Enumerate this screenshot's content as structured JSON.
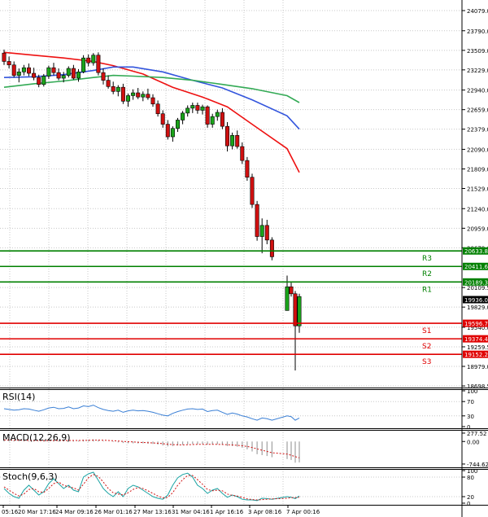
{
  "chart_data": {
    "type": "candlestick",
    "price_axis": {
      "ticks": [
        "24079.0",
        "23790.0",
        "23509.0",
        "23229.0",
        "22940.0",
        "22659.0",
        "22379.0",
        "22090.0",
        "21809.0",
        "21529.0",
        "21240.0",
        "20959.0",
        "20679.0",
        "20109.5",
        "19829.0",
        "19540.0",
        "19259.5",
        "18979.0",
        "18698.5"
      ],
      "current_price_label": "19936.0",
      "range": [
        18650,
        24120
      ]
    },
    "time_axis": {
      "labels": [
        "05:16",
        "20 Mar 17:16",
        "24 Mar 09:16",
        "26 Mar 01:16",
        "27 Mar 13:16",
        "31 Mar 04:16",
        "1 Apr 16:16",
        "3 Apr 08:16",
        "7 Apr 00:16"
      ]
    },
    "levels": [
      {
        "name": "R3",
        "value": 20633.8,
        "label": "20633.8",
        "color": "#008000"
      },
      {
        "name": "R2",
        "value": 20411.6,
        "label": "20411.6",
        "color": "#008000"
      },
      {
        "name": "R1",
        "value": 20189.3,
        "label": "20189.3",
        "color": "#008000"
      },
      {
        "name": "S1",
        "value": 19596.7,
        "label": "19596.7",
        "color": "#e00000"
      },
      {
        "name": "S2",
        "value": 19374.4,
        "label": "19374.4",
        "color": "#e00000"
      },
      {
        "name": "S3",
        "value": 19152.2,
        "label": "19152.2",
        "color": "#e00000"
      }
    ],
    "candles": [
      [
        23470,
        23520,
        23300,
        23350
      ],
      [
        23350,
        23420,
        23250,
        23300
      ],
      [
        23300,
        23350,
        23120,
        23150
      ],
      [
        23150,
        23250,
        23050,
        23200
      ],
      [
        23200,
        23300,
        23150,
        23260
      ],
      [
        23260,
        23320,
        23140,
        23180
      ],
      [
        23180,
        23260,
        23080,
        23120
      ],
      [
        23120,
        23160,
        22980,
        23020
      ],
      [
        23020,
        23170,
        22990,
        23140
      ],
      [
        23140,
        23290,
        23100,
        23260
      ],
      [
        23260,
        23330,
        23150,
        23190
      ],
      [
        23190,
        23250,
        23080,
        23110
      ],
      [
        23110,
        23200,
        23050,
        23150
      ],
      [
        23150,
        23280,
        23120,
        23250
      ],
      [
        23250,
        23300,
        23090,
        23110
      ],
      [
        23110,
        23240,
        23060,
        23200
      ],
      [
        23200,
        23440,
        23180,
        23400
      ],
      [
        23400,
        23450,
        23280,
        23330
      ],
      [
        23330,
        23470,
        23290,
        23440
      ],
      [
        23440,
        23480,
        23150,
        23190
      ],
      [
        23190,
        23250,
        23020,
        23080
      ],
      [
        23080,
        23150,
        22960,
        22990
      ],
      [
        22990,
        23060,
        22880,
        22920
      ],
      [
        22920,
        23010,
        22850,
        22980
      ],
      [
        22980,
        23030,
        22740,
        22780
      ],
      [
        22780,
        22890,
        22700,
        22860
      ],
      [
        22860,
        22950,
        22800,
        22900
      ],
      [
        22900,
        22970,
        22810,
        22840
      ],
      [
        22840,
        22920,
        22780,
        22880
      ],
      [
        22880,
        22960,
        22800,
        22830
      ],
      [
        22830,
        22880,
        22700,
        22740
      ],
      [
        22740,
        22790,
        22560,
        22600
      ],
      [
        22600,
        22650,
        22400,
        22450
      ],
      [
        22450,
        22510,
        22230,
        22270
      ],
      [
        22270,
        22420,
        22200,
        22390
      ],
      [
        22390,
        22540,
        22340,
        22510
      ],
      [
        22510,
        22640,
        22450,
        22610
      ],
      [
        22610,
        22720,
        22560,
        22680
      ],
      [
        22680,
        22760,
        22610,
        22720
      ],
      [
        22720,
        22760,
        22600,
        22650
      ],
      [
        22650,
        22730,
        22590,
        22700
      ],
      [
        22700,
        22720,
        22400,
        22450
      ],
      [
        22450,
        22600,
        22400,
        22560
      ],
      [
        22560,
        22660,
        22500,
        22620
      ],
      [
        22620,
        22680,
        22380,
        22420
      ],
      [
        22420,
        22480,
        22060,
        22140
      ],
      [
        22140,
        22330,
        22090,
        22290
      ],
      [
        22290,
        22360,
        22100,
        22130
      ],
      [
        22130,
        22190,
        21880,
        21930
      ],
      [
        21930,
        21980,
        21640,
        21690
      ],
      [
        21690,
        21740,
        21250,
        21300
      ],
      [
        21300,
        21350,
        20780,
        20840
      ],
      [
        20840,
        21100,
        20600,
        21000
      ],
      [
        21000,
        21080,
        20730,
        20790
      ],
      [
        20790,
        20830,
        20500,
        20550
      ],
      [
        19780,
        20280,
        19780,
        20120
      ],
      [
        20120,
        20180,
        19980,
        20020
      ],
      [
        20020,
        20060,
        18920,
        19560
      ],
      [
        19560,
        20020,
        19460,
        19980
      ]
    ],
    "moving_averages": [
      {
        "color": "#ee1111",
        "points": [
          [
            0,
            23480
          ],
          [
            6,
            23440
          ],
          [
            12,
            23400
          ],
          [
            18,
            23350
          ],
          [
            22,
            23290
          ],
          [
            28,
            23170
          ],
          [
            34,
            22980
          ],
          [
            40,
            22840
          ],
          [
            45,
            22700
          ],
          [
            50,
            22450
          ],
          [
            55,
            22100
          ],
          [
            58,
            21760
          ]
        ]
      },
      {
        "color": "#3355dd",
        "points": [
          [
            0,
            23120
          ],
          [
            6,
            23130
          ],
          [
            12,
            23160
          ],
          [
            18,
            23220
          ],
          [
            22,
            23270
          ],
          [
            26,
            23270
          ],
          [
            32,
            23200
          ],
          [
            38,
            23080
          ],
          [
            44,
            22970
          ],
          [
            50,
            22800
          ],
          [
            55,
            22570
          ],
          [
            58,
            22380
          ]
        ]
      },
      {
        "color": "#33aa55",
        "points": [
          [
            0,
            22980
          ],
          [
            6,
            23030
          ],
          [
            12,
            23070
          ],
          [
            18,
            23120
          ],
          [
            22,
            23150
          ],
          [
            26,
            23140
          ],
          [
            32,
            23120
          ],
          [
            38,
            23080
          ],
          [
            44,
            23020
          ],
          [
            50,
            22960
          ],
          [
            55,
            22860
          ],
          [
            58,
            22760
          ]
        ]
      }
    ],
    "indicators": {
      "rsi": {
        "label": "RSI(14)",
        "ticks": [
          "100",
          "70",
          "30",
          "0"
        ],
        "range": [
          0,
          100
        ],
        "values": [
          50,
          48,
          46,
          47,
          50,
          49,
          46,
          43,
          47,
          52,
          54,
          50,
          51,
          55,
          50,
          52,
          58,
          56,
          60,
          53,
          48,
          45,
          43,
          46,
          40,
          44,
          46,
          44,
          45,
          43,
          40,
          36,
          32,
          30,
          37,
          42,
          46,
          49,
          50,
          48,
          49,
          42,
          45,
          46,
          40,
          34,
          38,
          35,
          30,
          27,
          22,
          18,
          24,
          22,
          18,
          30,
          28,
          18,
          24
        ]
      },
      "macd": {
        "label": "MACD(12,26,9)",
        "ticks": [
          "277.52",
          "0.00",
          "-744.62"
        ],
        "range": [
          -800,
          330
        ],
        "histogram": [
          60,
          50,
          30,
          20,
          25,
          20,
          15,
          5,
          10,
          30,
          40,
          30,
          30,
          40,
          30,
          30,
          60,
          55,
          70,
          50,
          20,
          0,
          -20,
          -30,
          -50,
          -60,
          -60,
          -65,
          -60,
          -70,
          -80,
          -100,
          -130,
          -160,
          -150,
          -130,
          -110,
          -90,
          -80,
          -85,
          -80,
          -100,
          -95,
          -90,
          -110,
          -150,
          -150,
          -170,
          -210,
          -260,
          -330,
          -420,
          -450,
          -480,
          -520,
          -580,
          -610,
          -700,
          -690
        ],
        "signal": [
          50,
          48,
          45,
          42,
          40,
          38,
          35,
          32,
          30,
          31,
          33,
          33,
          33,
          34,
          33,
          33,
          37,
          40,
          45,
          46,
          42,
          35,
          25,
          15,
          5,
          -5,
          -15,
          -25,
          -32,
          -40,
          -48,
          -58,
          -72,
          -90,
          -102,
          -108,
          -110,
          -106,
          -100,
          -96,
          -93,
          -94,
          -95,
          -94,
          -97,
          -105,
          -114,
          -125,
          -142,
          -165,
          -198,
          -245,
          -290,
          -330,
          -372,
          -415,
          -455,
          -500,
          -540
        ]
      },
      "stoch": {
        "label": "Stoch(9,6,3)",
        "ticks": [
          "100",
          "80",
          "20",
          "0"
        ],
        "range": [
          0,
          100
        ],
        "main": [
          45,
          30,
          20,
          15,
          40,
          55,
          40,
          25,
          35,
          60,
          75,
          60,
          45,
          55,
          40,
          35,
          80,
          90,
          95,
          70,
          45,
          30,
          20,
          35,
          20,
          45,
          55,
          50,
          40,
          30,
          20,
          15,
          12,
          25,
          55,
          78,
          88,
          92,
          80,
          55,
          45,
          30,
          40,
          45,
          30,
          18,
          25,
          20,
          12,
          10,
          10,
          8,
          15,
          14,
          12,
          20,
          18,
          14,
          22
        ],
        "signal": [
          50,
          40,
          30,
          22,
          28,
          42,
          45,
          35,
          33,
          45,
          60,
          65,
          55,
          50,
          47,
          40,
          58,
          78,
          88,
          82,
          65,
          45,
          32,
          28,
          25,
          32,
          42,
          48,
          45,
          38,
          30,
          22,
          16,
          18,
          32,
          55,
          72,
          85,
          85,
          72,
          58,
          42,
          38,
          40,
          38,
          28,
          24,
          22,
          18,
          13,
          11,
          10,
          11,
          12,
          13,
          15,
          17,
          17,
          18
        ]
      }
    }
  }
}
